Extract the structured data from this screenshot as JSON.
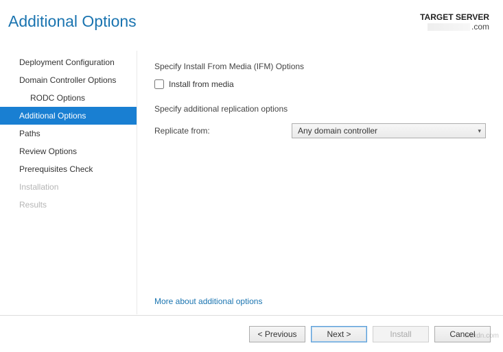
{
  "header": {
    "title": "Additional Options",
    "server_label": "TARGET SERVER",
    "server_suffix": ".com"
  },
  "sidebar": {
    "items": [
      {
        "label": "Deployment Configuration"
      },
      {
        "label": "Domain Controller Options"
      },
      {
        "label": "RODC Options"
      },
      {
        "label": "Additional Options"
      },
      {
        "label": "Paths"
      },
      {
        "label": "Review Options"
      },
      {
        "label": "Prerequisites Check"
      },
      {
        "label": "Installation"
      },
      {
        "label": "Results"
      }
    ]
  },
  "content": {
    "ifm_section": "Specify Install From Media (IFM) Options",
    "ifm_checkbox_label": "Install from media",
    "replication_section": "Specify additional replication options",
    "replicate_label": "Replicate from:",
    "replicate_value": "Any domain controller",
    "more_link": "More about additional options"
  },
  "footer": {
    "previous": "< Previous",
    "next": "Next >",
    "install": "Install",
    "cancel": "Cancel"
  },
  "watermark": "wsxdn.com"
}
